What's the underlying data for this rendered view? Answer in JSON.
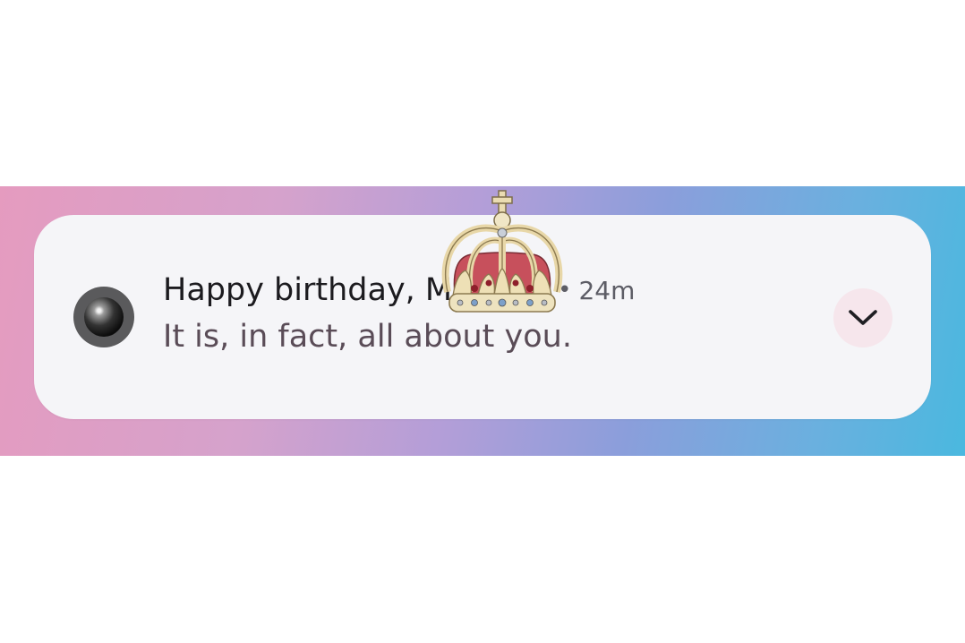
{
  "notification": {
    "app_icon": "dark-ball-icon",
    "title": "Happy birthday, M",
    "separator": "•",
    "time": "24m",
    "body": "It is, in fact, all about you.",
    "expand_icon": "chevron-down-icon",
    "sticker": "crown-icon"
  },
  "colors": {
    "band_start": "#e59bbf",
    "band_mid": "#b39ed8",
    "band_end": "#4ab8df",
    "card": "#f5f5f8",
    "title": "#1c1b1f",
    "body": "#5a4c57",
    "expand_bg": "#f6e6ec"
  }
}
